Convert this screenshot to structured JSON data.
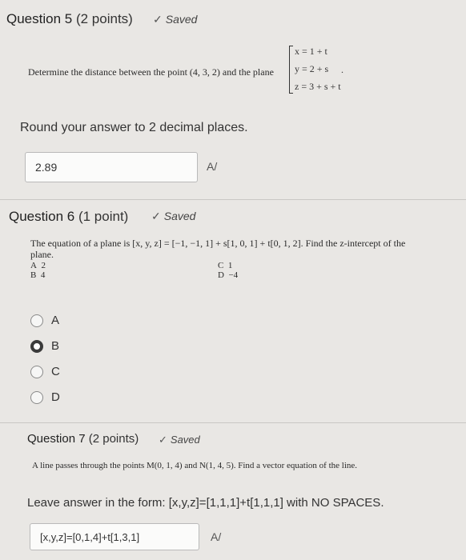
{
  "q5": {
    "title": "Question 5",
    "points": "(2 points)",
    "saved": "Saved",
    "prompt": "Determine the distance between the point (4, 3, 2) and the plane",
    "system": [
      "x = 1 + t",
      "y = 2 + s",
      "z = 3 + s + t"
    ],
    "period": ".",
    "instruction": "Round your answer to 2 decimal places.",
    "answer": "2.89"
  },
  "q6": {
    "title": "Question 6",
    "points": "(1 point)",
    "saved": "Saved",
    "prompt_line1": "The equation of a plane is [x, y, z] = [−1, −1, 1] + s[1, 0, 1] + t[0, 1, 2]. Find the z-intercept of the",
    "prompt_line2": "plane.",
    "choices_text": [
      {
        "letter": "A",
        "value": "2"
      },
      {
        "letter": "B",
        "value": "4"
      },
      {
        "letter": "C",
        "value": "1"
      },
      {
        "letter": "D",
        "value": "−4"
      }
    ],
    "options": [
      "A",
      "B",
      "C",
      "D"
    ],
    "selected": "B"
  },
  "q7": {
    "title": "Question 7",
    "points": "(2 points)",
    "saved": "Saved",
    "prompt": "A line passes through the points M(0, 1, 4) and  N(1, 4, 5). Find a vector equation of the line.",
    "instruction": "Leave answer in the form: [x,y,z]=[1,1,1]+t[1,1,1] with NO SPACES.",
    "answer": "[x,y,z]=[0,1,4]+t[1,3,1]"
  },
  "icons": {
    "check": "checkmark-icon",
    "spellcheck": "spellcheck-icon"
  }
}
